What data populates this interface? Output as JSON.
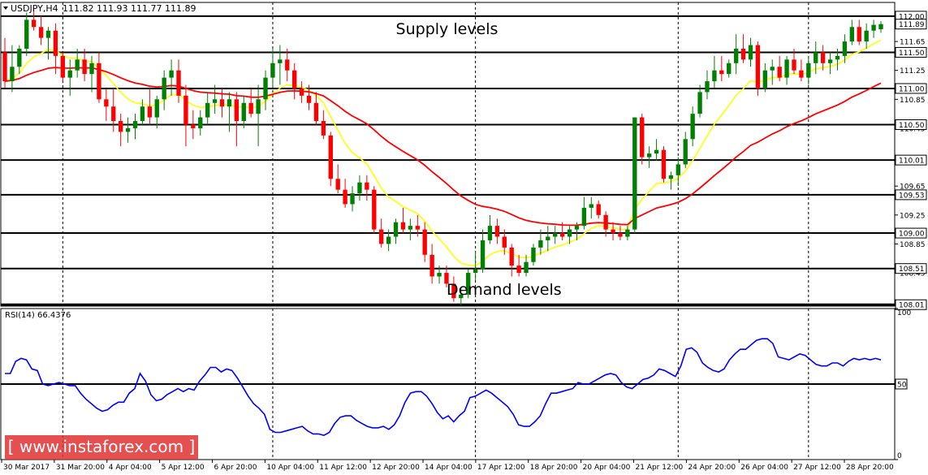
{
  "chart_data": [
    {
      "type": "candlestick",
      "title": "USDJPY,H4",
      "ohlc_header": "111.82 111.93 111.77 111.89",
      "y_tick_labels": [
        "111.65",
        "111.25",
        "110.85",
        "110.45",
        "109.65",
        "109.25",
        "108.85",
        "108.45"
      ],
      "ylim": [
        107.99,
        112.19
      ],
      "grid": false,
      "x_tick_labels": [
        "30 Mar 2017",
        "31 Mar 20:00",
        "4 Apr 04:00",
        "5 Apr 12:00",
        "6 Apr 20:00",
        "10 Apr 04:00",
        "11 Apr 12:00",
        "12 Apr 20:00",
        "14 Apr 04:00",
        "17 Apr 12:00",
        "18 Apr 20:00",
        "20 Apr 04:00",
        "21 Apr 12:00",
        "24 Apr 20:00",
        "26 Apr 04:00",
        "27 Apr 12:00",
        "28 Apr 20:00"
      ],
      "levels": [
        {
          "label": "112.00",
          "value": 112.0,
          "highlight": true
        },
        {
          "label": "111.89",
          "value": 111.89,
          "highlight": true
        },
        {
          "label": "111.50",
          "value": 111.5,
          "highlight": true
        },
        {
          "label": "111.00",
          "value": 111.0,
          "highlight": true
        },
        {
          "label": "110.50",
          "value": 110.5,
          "highlight": true
        },
        {
          "label": "110.01",
          "value": 110.01,
          "highlight": true
        },
        {
          "label": "109.53",
          "value": 109.53,
          "highlight": true
        },
        {
          "label": "109.00",
          "value": 109.0,
          "highlight": true
        },
        {
          "label": "108.51",
          "value": 108.51,
          "highlight": true
        },
        {
          "label": "108.01",
          "value": 108.01,
          "highlight": true
        }
      ],
      "annotations": [
        {
          "text": "Supply levels",
          "x_bar": 118,
          "y": 111.75
        },
        {
          "text": "Demand levels",
          "x_bar": 132,
          "y": 108.15
        }
      ],
      "candles": [
        [
          111.5,
          111.7,
          111.0,
          111.1
        ],
        [
          111.1,
          111.6,
          110.95,
          111.3
        ],
        [
          111.3,
          111.6,
          111.2,
          111.55
        ],
        [
          111.55,
          112.05,
          111.45,
          111.95
        ],
        [
          111.95,
          112.1,
          111.8,
          111.85
        ],
        [
          111.85,
          112.0,
          111.6,
          111.7
        ],
        [
          111.7,
          111.85,
          111.4,
          111.8
        ],
        [
          111.8,
          111.9,
          111.2,
          111.45
        ],
        [
          111.45,
          111.5,
          111.1,
          111.15
        ],
        [
          111.15,
          111.4,
          110.9,
          111.25
        ],
        [
          111.25,
          111.55,
          111.15,
          111.4
        ],
        [
          111.4,
          111.55,
          111.1,
          111.2
        ],
        [
          111.2,
          111.45,
          110.95,
          111.35
        ],
        [
          111.35,
          111.5,
          110.8,
          110.85
        ],
        [
          110.85,
          111.0,
          110.55,
          110.75
        ],
        [
          110.75,
          111.0,
          110.4,
          110.55
        ],
        [
          110.55,
          110.65,
          110.2,
          110.4
        ],
        [
          110.4,
          110.6,
          110.25,
          110.45
        ],
        [
          110.45,
          110.65,
          110.3,
          110.55
        ],
        [
          110.55,
          110.85,
          110.5,
          110.75
        ],
        [
          110.75,
          111.0,
          110.5,
          110.6
        ],
        [
          110.6,
          110.9,
          110.45,
          110.85
        ],
        [
          110.85,
          111.25,
          110.7,
          111.15
        ],
        [
          111.15,
          111.4,
          110.9,
          111.25
        ],
        [
          111.25,
          111.4,
          110.8,
          110.9
        ],
        [
          110.9,
          111.05,
          110.2,
          110.5
        ],
        [
          110.5,
          110.7,
          110.3,
          110.45
        ],
        [
          110.45,
          110.7,
          110.35,
          110.6
        ],
        [
          110.6,
          110.95,
          110.5,
          110.8
        ],
        [
          110.8,
          111.05,
          110.65,
          110.85
        ],
        [
          110.85,
          111.0,
          110.6,
          110.75
        ],
        [
          110.75,
          110.95,
          110.4,
          110.85
        ],
        [
          110.85,
          110.95,
          110.2,
          110.55
        ],
        [
          110.55,
          110.9,
          110.45,
          110.8
        ],
        [
          110.8,
          111.0,
          110.6,
          110.65
        ],
        [
          110.65,
          111.05,
          110.2,
          110.85
        ],
        [
          110.85,
          111.25,
          110.7,
          111.15
        ],
        [
          111.15,
          111.55,
          111.0,
          111.35
        ],
        [
          111.35,
          111.6,
          111.05,
          111.4
        ],
        [
          111.4,
          111.55,
          111.1,
          111.25
        ],
        [
          111.25,
          111.35,
          110.85,
          111.0
        ],
        [
          111.0,
          111.1,
          110.8,
          110.9
        ],
        [
          110.9,
          111.05,
          110.7,
          110.8
        ],
        [
          110.8,
          110.95,
          110.5,
          110.55
        ],
        [
          110.55,
          110.7,
          110.3,
          110.35
        ],
        [
          110.35,
          110.4,
          109.65,
          109.75
        ],
        [
          109.75,
          109.95,
          109.55,
          109.6
        ],
        [
          109.6,
          109.75,
          109.35,
          109.4
        ],
        [
          109.4,
          109.65,
          109.3,
          109.55
        ],
        [
          109.55,
          109.8,
          109.45,
          109.7
        ],
        [
          109.7,
          109.8,
          109.45,
          109.6
        ],
        [
          109.6,
          109.65,
          109.0,
          109.05
        ],
        [
          109.05,
          109.2,
          108.8,
          108.85
        ],
        [
          108.85,
          109.05,
          108.75,
          108.95
        ],
        [
          108.95,
          109.2,
          108.85,
          109.15
        ],
        [
          109.15,
          109.35,
          109.0,
          109.05
        ],
        [
          109.05,
          109.2,
          108.9,
          109.1
        ],
        [
          109.1,
          109.25,
          108.95,
          109.05
        ],
        [
          109.05,
          109.15,
          108.6,
          108.7
        ],
        [
          108.7,
          108.85,
          108.3,
          108.4
        ],
        [
          108.4,
          108.55,
          108.3,
          108.45
        ],
        [
          108.45,
          108.55,
          108.25,
          108.3
        ],
        [
          108.3,
          108.4,
          108.05,
          108.1
        ],
        [
          108.1,
          108.25,
          108.0,
          108.15
        ],
        [
          108.15,
          108.5,
          108.1,
          108.45
        ],
        [
          108.45,
          108.75,
          108.35,
          108.5
        ],
        [
          108.5,
          109.05,
          108.45,
          108.9
        ],
        [
          108.9,
          109.25,
          108.85,
          109.1
        ],
        [
          109.1,
          109.2,
          108.85,
          108.95
        ],
        [
          108.95,
          109.05,
          108.7,
          108.8
        ],
        [
          108.8,
          108.85,
          108.4,
          108.55
        ],
        [
          108.55,
          108.7,
          108.4,
          108.45
        ],
        [
          108.45,
          108.7,
          108.4,
          108.6
        ],
        [
          108.6,
          108.85,
          108.55,
          108.8
        ],
        [
          108.8,
          109.05,
          108.7,
          108.9
        ],
        [
          108.9,
          109.1,
          108.75,
          108.95
        ],
        [
          108.95,
          109.1,
          108.85,
          109.0
        ],
        [
          109.0,
          109.15,
          108.9,
          108.95
        ],
        [
          108.95,
          109.1,
          108.85,
          109.05
        ],
        [
          109.05,
          109.15,
          108.9,
          109.1
        ],
        [
          109.1,
          109.5,
          109.05,
          109.35
        ],
        [
          109.35,
          109.5,
          109.2,
          109.4
        ],
        [
          109.4,
          109.45,
          109.2,
          109.25
        ],
        [
          109.25,
          109.3,
          108.95,
          109.05
        ],
        [
          109.05,
          109.15,
          108.9,
          109.0
        ],
        [
          109.0,
          109.1,
          108.9,
          108.95
        ],
        [
          108.95,
          109.1,
          108.9,
          109.05
        ],
        [
          109.05,
          110.6,
          109.0,
          110.6
        ],
        [
          110.6,
          110.65,
          109.95,
          110.05
        ],
        [
          110.05,
          110.2,
          109.9,
          110.1
        ],
        [
          110.1,
          110.3,
          110.0,
          110.15
        ],
        [
          110.15,
          110.2,
          109.7,
          109.75
        ],
        [
          109.75,
          109.85,
          109.6,
          109.8
        ],
        [
          109.8,
          110.05,
          109.65,
          109.95
        ],
        [
          109.95,
          110.4,
          109.9,
          110.3
        ],
        [
          110.3,
          110.75,
          110.2,
          110.65
        ],
        [
          110.65,
          111.05,
          110.6,
          110.95
        ],
        [
          110.95,
          111.25,
          110.85,
          111.1
        ],
        [
          111.1,
          111.45,
          111.0,
          111.25
        ],
        [
          111.25,
          111.45,
          111.1,
          111.2
        ],
        [
          111.2,
          111.4,
          111.15,
          111.35
        ],
        [
          111.35,
          111.75,
          111.2,
          111.55
        ],
        [
          111.55,
          111.75,
          111.35,
          111.4
        ],
        [
          111.4,
          111.7,
          111.3,
          111.6
        ],
        [
          111.6,
          111.65,
          110.9,
          111.0
        ],
        [
          111.0,
          111.35,
          110.95,
          111.25
        ],
        [
          111.25,
          111.4,
          111.05,
          111.3
        ],
        [
          111.3,
          111.45,
          111.1,
          111.15
        ],
        [
          111.15,
          111.45,
          111.05,
          111.4
        ],
        [
          111.4,
          111.55,
          111.2,
          111.25
        ],
        [
          111.25,
          111.4,
          111.1,
          111.15
        ],
        [
          111.15,
          111.45,
          111.05,
          111.35
        ],
        [
          111.35,
          111.65,
          111.2,
          111.5
        ],
        [
          111.5,
          111.6,
          111.25,
          111.35
        ],
        [
          111.35,
          111.5,
          111.2,
          111.4
        ],
        [
          111.4,
          111.55,
          111.25,
          111.45
        ],
        [
          111.45,
          111.75,
          111.35,
          111.65
        ],
        [
          111.65,
          111.95,
          111.6,
          111.85
        ],
        [
          111.85,
          111.95,
          111.6,
          111.65
        ],
        [
          111.65,
          111.9,
          111.55,
          111.8
        ],
        [
          111.8,
          111.95,
          111.7,
          111.88
        ],
        [
          111.82,
          111.93,
          111.77,
          111.89
        ]
      ],
      "ema_fast_color": "#ffff00",
      "ema_slow_color": "#ff0000",
      "bull_color": "#008000",
      "bear_color": "#ff0000"
    },
    {
      "type": "line",
      "title": "RSI(14) 66.4376",
      "ylim": [
        0,
        100
      ],
      "y_tick_labels": [
        "100",
        "50",
        "0"
      ],
      "level": 50,
      "line_color": "#0000ff",
      "values": [
        57,
        57,
        65,
        67,
        66,
        60,
        59,
        50,
        49,
        50,
        51,
        50,
        49,
        49,
        44,
        40,
        37,
        34,
        32,
        33,
        36,
        38,
        38,
        44,
        47,
        57,
        52,
        43,
        39,
        40,
        43,
        45,
        47,
        45,
        47,
        46,
        52,
        56,
        61,
        61,
        58,
        60,
        59,
        54,
        48,
        42,
        37,
        34,
        30,
        20,
        18,
        18,
        19,
        20,
        21,
        22,
        19,
        17,
        17,
        16,
        18,
        24,
        28,
        29,
        29,
        26,
        24,
        22,
        21,
        21,
        22,
        20,
        23,
        29,
        38,
        44,
        45,
        45,
        42,
        37,
        31,
        27,
        29,
        25,
        29,
        32,
        41,
        42,
        44,
        46,
        44,
        41,
        38,
        35,
        30,
        23,
        22,
        22,
        25,
        29,
        37,
        44,
        44,
        45,
        46,
        47,
        51,
        50,
        50,
        52,
        54,
        56,
        57,
        56,
        51,
        48,
        47,
        50,
        53,
        54,
        56,
        60,
        59,
        57,
        55,
        62,
        73,
        74,
        71,
        64,
        61,
        59,
        58,
        60,
        66,
        70,
        73,
        73,
        76,
        79,
        80,
        80,
        77,
        68,
        67,
        66,
        68,
        70,
        69,
        66,
        63,
        62,
        62,
        64,
        64,
        62,
        65,
        67,
        66,
        67,
        66,
        67,
        66
      ]
    }
  ],
  "watermark": "[ www.instaforex.com ]"
}
